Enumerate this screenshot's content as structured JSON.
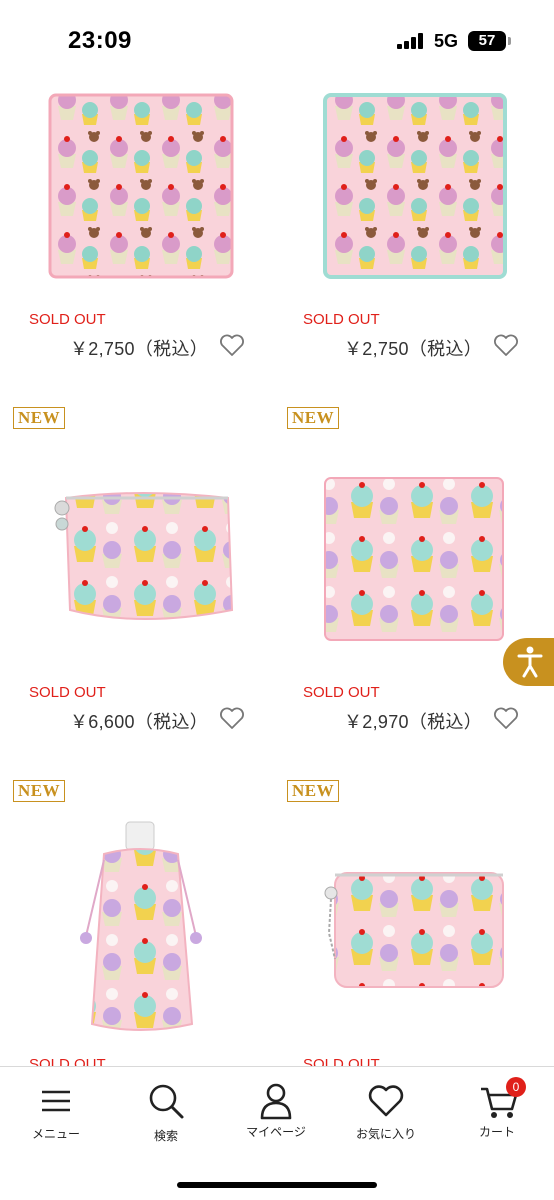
{
  "status_bar": {
    "time": "23:09",
    "network": "5G",
    "battery": "57"
  },
  "products": [
    {
      "badge": "",
      "status": "SOLD OUT",
      "price": "￥2,750（税込）",
      "item": "pink towel handkerchief"
    },
    {
      "badge": "",
      "status": "SOLD OUT",
      "price": "￥2,750（税込）",
      "item": "mint towel handkerchief"
    },
    {
      "badge": "NEW",
      "status": "SOLD OUT",
      "price": "￥6,600（税込）",
      "item": "pouch"
    },
    {
      "badge": "NEW",
      "status": "SOLD OUT",
      "price": "￥2,970（税込）",
      "item": "folded towel"
    },
    {
      "badge": "NEW",
      "status": "SOLD OUT",
      "item": "bottle holder"
    },
    {
      "badge": "NEW",
      "status": "SOLD OUT",
      "item": "card pouch"
    }
  ],
  "bottom_nav": {
    "menu": "メニュー",
    "search": "検索",
    "mypage": "マイページ",
    "favorites": "お気に入り",
    "cart": "カート",
    "cart_count": "0"
  },
  "colors": {
    "accent": "#c8911f",
    "sold_out": "#e0201a",
    "pink": "#f7c9d2",
    "mint": "#9fdcd3"
  }
}
